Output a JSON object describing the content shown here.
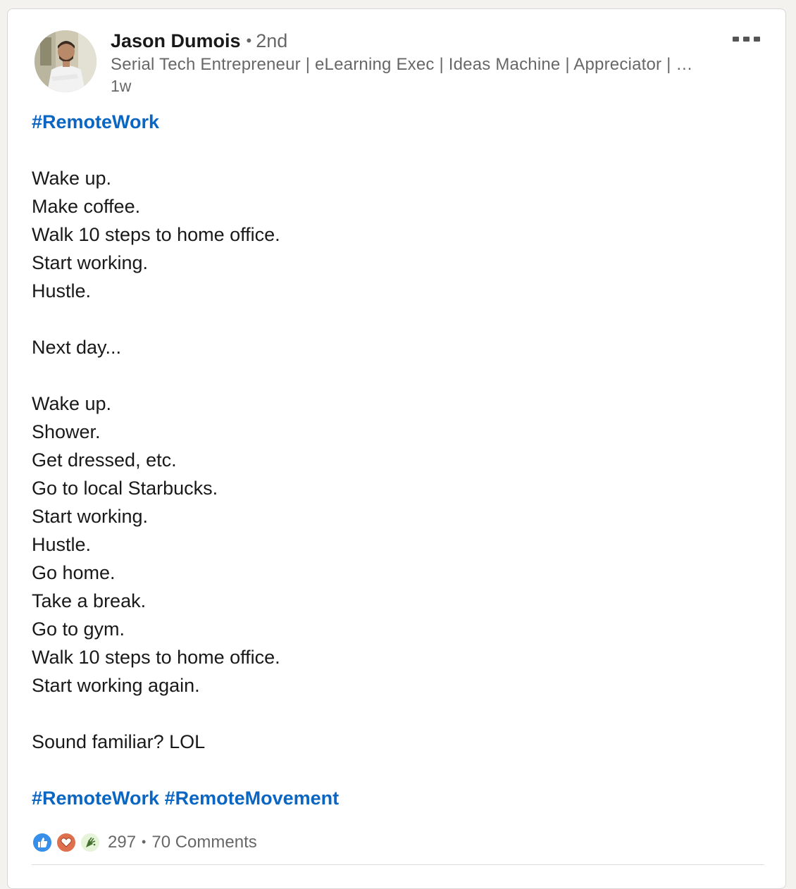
{
  "author": {
    "name": "Jason Dumois",
    "degree": "2nd",
    "headline": "Serial Tech Entrepreneur | eLearning Exec | Ideas Machine | Appreciator | …",
    "time_ago": "1w"
  },
  "post": {
    "lines": [
      {
        "hashtags": [
          "#RemoteWork"
        ]
      },
      {
        "text": ""
      },
      {
        "text": "Wake up."
      },
      {
        "text": "Make coffee."
      },
      {
        "text": "Walk 10 steps to home office."
      },
      {
        "text": "Start working."
      },
      {
        "text": "Hustle."
      },
      {
        "text": ""
      },
      {
        "text": "Next day..."
      },
      {
        "text": ""
      },
      {
        "text": "Wake up."
      },
      {
        "text": "Shower."
      },
      {
        "text": "Get dressed, etc."
      },
      {
        "text": "Go to local Starbucks."
      },
      {
        "text": "Start working."
      },
      {
        "text": "Hustle."
      },
      {
        "text": "Go home."
      },
      {
        "text": "Take a break."
      },
      {
        "text": "Go to gym."
      },
      {
        "text": "Walk 10 steps to home office."
      },
      {
        "text": "Start working again."
      },
      {
        "text": ""
      },
      {
        "text": "Sound familiar? LOL"
      },
      {
        "text": ""
      },
      {
        "hashtags": [
          "#RemoteWork",
          "#RemoteMovement"
        ]
      }
    ]
  },
  "social": {
    "reactions": [
      {
        "icon": "like-reaction-icon",
        "color": "#378fe9"
      },
      {
        "icon": "love-reaction-icon",
        "color": "#df704d"
      },
      {
        "icon": "celebrate-reaction-icon",
        "color": "#44712e"
      }
    ],
    "reaction_count": "297",
    "separator": "•",
    "comments": "70 Comments"
  },
  "colors": {
    "hashtag": "#0a66c2",
    "text": "#191919",
    "secondary_text": "#666666"
  }
}
